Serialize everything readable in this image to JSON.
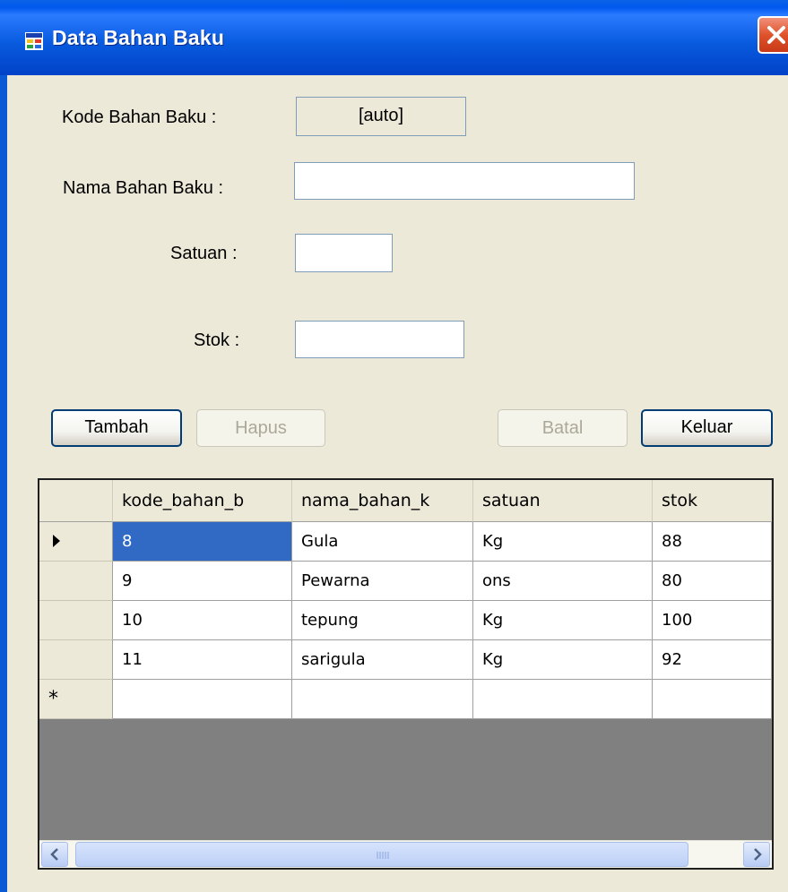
{
  "window": {
    "title": "Data Bahan Baku"
  },
  "form": {
    "kode_label": "Kode Bahan Baku :",
    "kode_value": "[auto]",
    "nama_label": "Nama Bahan Baku :",
    "nama_value": "",
    "satuan_label": "Satuan :",
    "satuan_value": "",
    "stok_label": "Stok :",
    "stok_value": ""
  },
  "buttons": {
    "tambah": "Tambah",
    "hapus": "Hapus",
    "batal": "Batal",
    "keluar": "Keluar"
  },
  "grid": {
    "columns": [
      "kode_bahan_b",
      "nama_bahan_k",
      "satuan",
      "stok"
    ],
    "rows": [
      [
        "8",
        "Gula",
        "Kg",
        "88"
      ],
      [
        "9",
        "Pewarna",
        "ons",
        "80"
      ],
      [
        "10",
        "tepung",
        "Kg",
        "100"
      ],
      [
        "11",
        "sarigula",
        "Kg",
        "92"
      ]
    ],
    "selected_row": 0,
    "new_row_marker": "*"
  },
  "colors": {
    "selection": "#316ac5",
    "titlebar": "#0a5ce0",
    "form_background": "#ece9d8",
    "grid_background": "#808080"
  }
}
